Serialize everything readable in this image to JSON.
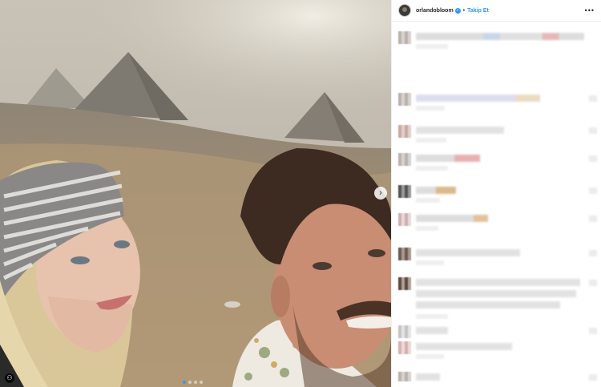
{
  "post": {
    "username": "orlandobloom",
    "separator": "•",
    "follow_label": "Takip Et",
    "more_label": "•••",
    "verified_glyph": "✓",
    "verified_color": "#3897f0",
    "next_glyph": "›",
    "accent_color": "#3897f0",
    "photo_description_icons": [
      "next-arrow-icon",
      "tag-icon",
      "carousel-dots"
    ],
    "comments_blurred": true,
    "comment_count_visible": 11
  }
}
